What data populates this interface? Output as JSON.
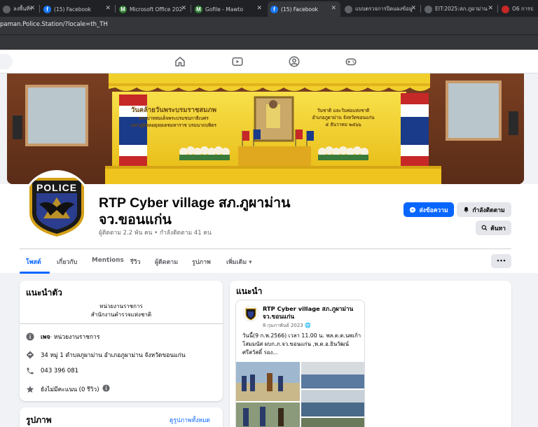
{
  "browser": {
    "tabs": [
      {
        "label": "ลงพื้นที่ข้อมูล",
        "favicon": "generic-icon",
        "color": "#5f6368"
      },
      {
        "label": "(15) Facebook",
        "favicon": "facebook-icon",
        "color": "#1877f2"
      },
      {
        "label": "Microsoft Office 2024",
        "favicon": "mawto-icon",
        "color": "#2e7d32"
      },
      {
        "label": "Gofile - Mawto",
        "favicon": "mawto-icon",
        "color": "#2e7d32"
      },
      {
        "label": "(15) Facebook",
        "favicon": "facebook-icon",
        "color": "#1877f2"
      },
      {
        "label": "แบบตรวจการปิดแผงข้อมู",
        "favicon": "globe-icon",
        "color": "#5f6368"
      },
      {
        "label": "EIT:2025:สภ.ภูผาม่าน",
        "favicon": "globe-icon",
        "color": "#5f6368"
      },
      {
        "label": "O6 การประยุกต์",
        "favicon": "book-icon",
        "color": "#c62828"
      }
    ],
    "url": "paman.Police.Station/?locale=th_TH"
  },
  "page": {
    "name": "RTP Cyber village สภ.ภูผาม่าน จว.ขอนแก่น",
    "stats": "ผู้ติดตาม 2.2 พัน คน • กำลังติดตาม 41 คน",
    "message_button": "ส่งข้อความ",
    "following_button": "กำลังติดตาม",
    "search_button": "ค้นหา",
    "more_button": "•••"
  },
  "profile_tabs": [
    {
      "label": "โพสต์",
      "active": true
    },
    {
      "label": "เกี่ยวกับ",
      "active": false
    },
    {
      "label": "Mentions",
      "active": false
    },
    {
      "label": "รีวิว",
      "active": false
    },
    {
      "label": "ผู้ติดตาม",
      "active": false
    },
    {
      "label": "รูปภาพ",
      "active": false
    },
    {
      "label": "เพิ่มเติม ▾",
      "active": false
    }
  ],
  "intro": {
    "title": "แนะนำตัว",
    "line1": "หน่วยงานราชการ",
    "line2": "สำนักงานตำรวจแห่งชาติ",
    "rows": [
      {
        "icon": "info-icon",
        "bold": "เพจ",
        "text": " · หน่วยงานราชการ"
      },
      {
        "icon": "location-icon",
        "bold": "",
        "text": "34 หมู่ 1 ตำบลภูผาม่าน อำเภอภูผาม่าน จังหวัดขอนแก่น"
      },
      {
        "icon": "phone-icon",
        "bold": "",
        "text": "043 396 081"
      },
      {
        "icon": "star-icon",
        "bold": "",
        "text": "ยังไม่มีคะแนน (0 รีวิว)"
      }
    ]
  },
  "photos": {
    "title": "รูปภาพ",
    "see_all": "ดูรูปภาพทั้งหมด"
  },
  "featured": {
    "title": "แนะนำ",
    "post_author": "RTP Cyber village สภ.ภูผาม่าน จว.ขอนแก่น",
    "post_date": "8 กุมภาพันธ์ 2023",
    "post_text": "วันนี้(9 ก.พ.2566) เวลา 11.00 น. พล.ต.ต.นพเก้า โสมมนัส ผบก.ภ.จว.ขอนแก่น ,พ.ต.อ.ยินวัฒน์ ศรีสวัสดิ์ รอง..."
  },
  "cover": {
    "banner_line1": "วันคล้ายวันพระบรมราชสมภพ",
    "banner_line2": "พระบาทสมเด็จพระบรมชนกาธิเบศร",
    "banner_line3": "มหาภูมิพลอดุลยเดชมหาราช บรมนาถบพิตร",
    "banner_right1": "วันชาติ และวันพ่อแห่งชาติ",
    "banner_right2": "อำเภอภูผาม่าน จังหวัดขอนแก่น",
    "banner_right3": "๕ ธันวาคม ๒๕๖๖"
  },
  "avatar": {
    "label": "POLICE"
  },
  "colors": {
    "accent": "#1877f2",
    "fb_blue": "#0866ff",
    "cover_yellow": "#f2d22e"
  }
}
